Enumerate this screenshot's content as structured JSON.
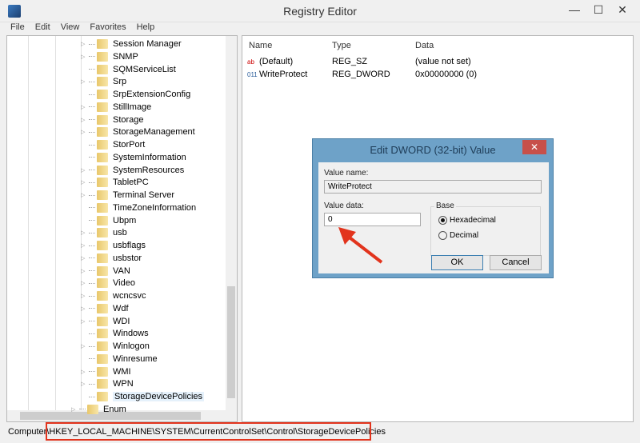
{
  "window": {
    "title": "Registry Editor",
    "minimize": "—",
    "maximize": "☐",
    "close": "✕"
  },
  "menu": [
    "File",
    "Edit",
    "View",
    "Favorites",
    "Help"
  ],
  "tree": [
    {
      "label": "Session Manager",
      "expandable": true
    },
    {
      "label": "SNMP",
      "expandable": true
    },
    {
      "label": "SQMServiceList",
      "expandable": false
    },
    {
      "label": "Srp",
      "expandable": true
    },
    {
      "label": "SrpExtensionConfig",
      "expandable": false
    },
    {
      "label": "StillImage",
      "expandable": true
    },
    {
      "label": "Storage",
      "expandable": true
    },
    {
      "label": "StorageManagement",
      "expandable": true
    },
    {
      "label": "StorPort",
      "expandable": false
    },
    {
      "label": "SystemInformation",
      "expandable": false
    },
    {
      "label": "SystemResources",
      "expandable": true
    },
    {
      "label": "TabletPC",
      "expandable": true
    },
    {
      "label": "Terminal Server",
      "expandable": true
    },
    {
      "label": "TimeZoneInformation",
      "expandable": false
    },
    {
      "label": "Ubpm",
      "expandable": false
    },
    {
      "label": "usb",
      "expandable": true
    },
    {
      "label": "usbflags",
      "expandable": true
    },
    {
      "label": "usbstor",
      "expandable": true
    },
    {
      "label": "VAN",
      "expandable": true
    },
    {
      "label": "Video",
      "expandable": true
    },
    {
      "label": "wcncsvc",
      "expandable": true
    },
    {
      "label": "Wdf",
      "expandable": true
    },
    {
      "label": "WDI",
      "expandable": true
    },
    {
      "label": "Windows",
      "expandable": false
    },
    {
      "label": "Winlogon",
      "expandable": true
    },
    {
      "label": "Winresume",
      "expandable": false
    },
    {
      "label": "WMI",
      "expandable": true
    },
    {
      "label": "WPN",
      "expandable": true
    },
    {
      "label": "StorageDevicePolicies",
      "expandable": false,
      "selected": true
    },
    {
      "label": "Enum",
      "expandable": true
    }
  ],
  "list": {
    "headers": [
      "Name",
      "Type",
      "Data"
    ],
    "rows": [
      {
        "icon": "ab",
        "name": "(Default)",
        "type": "REG_SZ",
        "data": "(value not set)"
      },
      {
        "icon": "011",
        "name": "WriteProtect",
        "type": "REG_DWORD",
        "data": "0x00000000 (0)"
      }
    ]
  },
  "status": {
    "prefix": "Computer\\",
    "path": "HKEY_LOCAL_MACHINE\\SYSTEM\\CurrentControlSet\\Control\\StorageDevicePolicies",
    "highlight_color": "#e2341d"
  },
  "dialog": {
    "title": "Edit DWORD (32-bit) Value",
    "close": "✕",
    "value_name_label": "Value name:",
    "value_name": "WriteProtect",
    "value_data_label": "Value data:",
    "value_data": "0",
    "base_label": "Base",
    "hex": "Hexadecimal",
    "dec": "Decimal",
    "selected_base": "Hexadecimal",
    "ok": "OK",
    "cancel": "Cancel"
  }
}
